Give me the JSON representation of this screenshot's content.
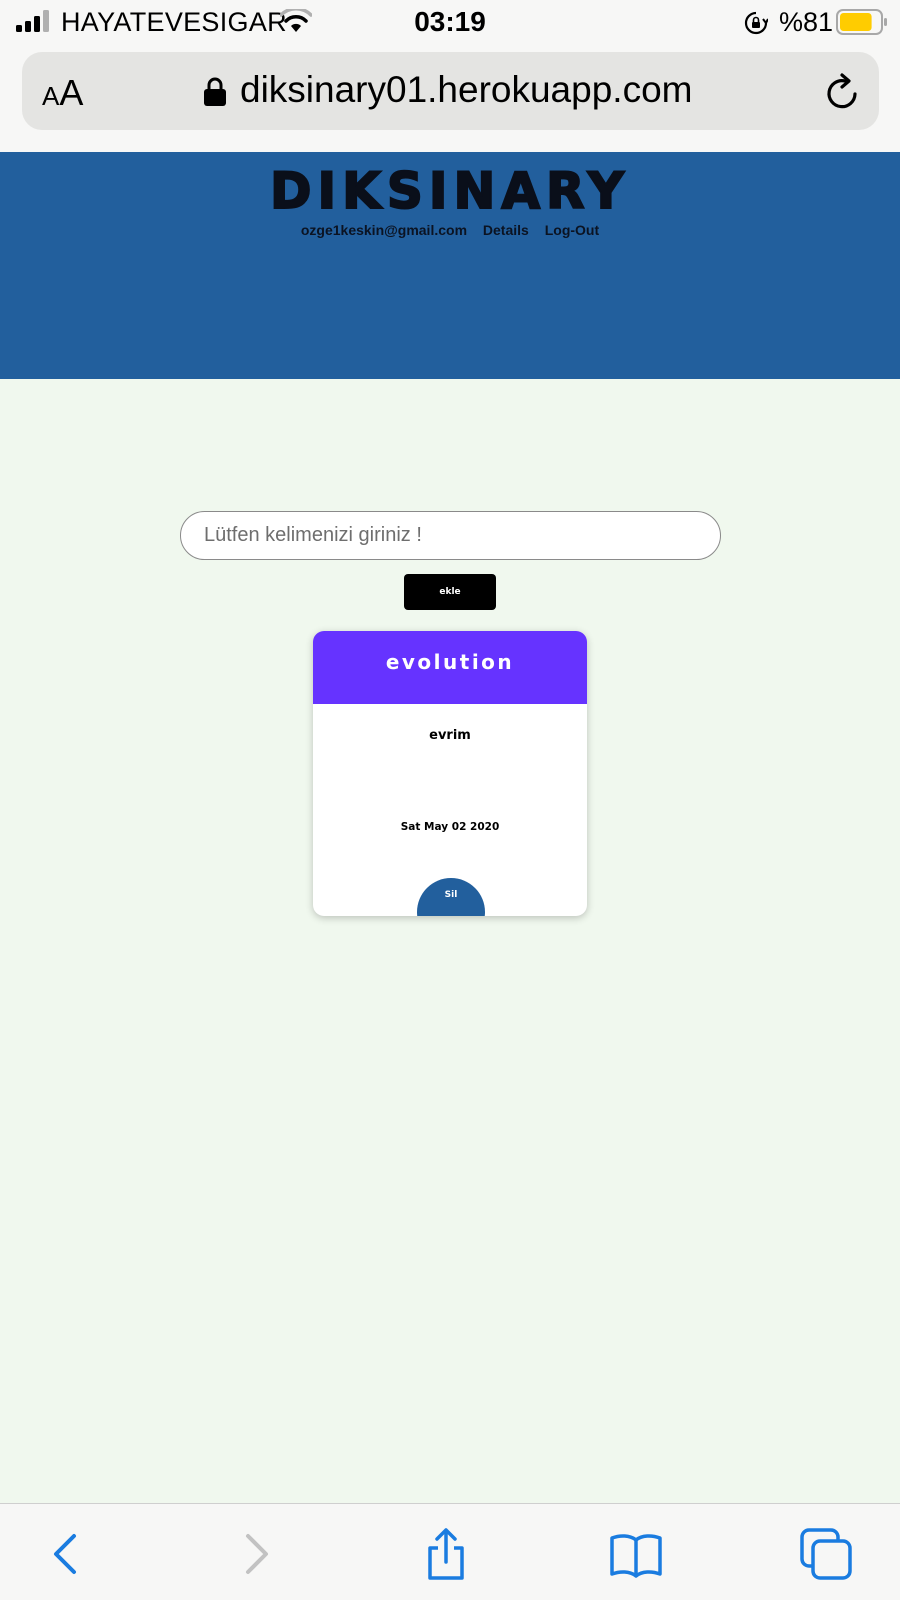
{
  "status_bar": {
    "carrier": "HAYATEVESIGAR",
    "time": "03:19",
    "battery_percent": "%81",
    "battery_level": 0.81,
    "signal_icon": "signal-bars-icon",
    "wifi_icon": "wifi-icon",
    "rotation_lock_icon": "rotation-lock-icon",
    "battery_icon": "battery-icon",
    "battery_color": "#ffcc00"
  },
  "browser": {
    "text_size_small": "A",
    "text_size_big": "A",
    "url": "diksinary01.herokuapp.com",
    "lock_icon": "lock-icon",
    "reload_icon": "reload-icon",
    "toolbar_icons": [
      "back-icon",
      "forward-icon",
      "share-icon",
      "bookmarks-icon",
      "tabs-icon"
    ],
    "accent_color": "#1a7ce0"
  },
  "header": {
    "logo": "DIKSINARY",
    "email": "ozge1keskin@gmail.com",
    "details_label": "Details",
    "logout_label": "Log-Out",
    "background_color": "#225f9d"
  },
  "form": {
    "placeholder": "Lütfen kelimenizi giriniz !",
    "value": "",
    "add_label": "ekle"
  },
  "cards": [
    {
      "word": "evolution",
      "meaning": "evrim",
      "date": "Sat May 02 2020",
      "delete_label": "Sil",
      "header_color": "#6633ff"
    }
  ]
}
